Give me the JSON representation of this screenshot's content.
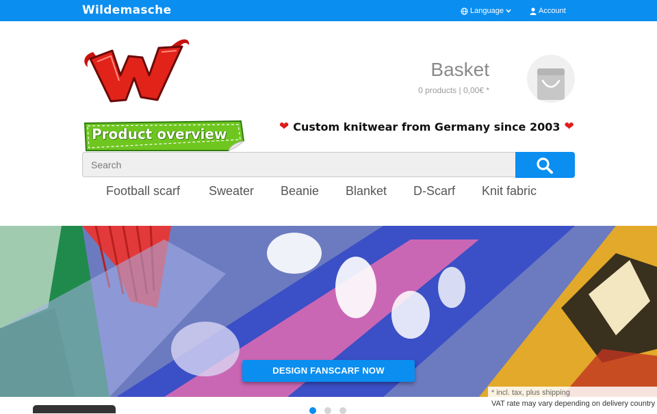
{
  "topbar": {
    "brand": "Wildemasche",
    "language_label": "Language",
    "account_label": "Account",
    "color": "#0a8ef0"
  },
  "header": {
    "basket_title": "Basket",
    "basket_info": "0 products | 0,00€ *",
    "badge_text": "Product overview",
    "tagline": "Custom knitwear from Germany since 2003"
  },
  "search": {
    "placeholder": "Search"
  },
  "categories": [
    "Football scarf",
    "Sweater",
    "Beanie",
    "Blanket",
    "D-Scarf",
    "Knit fabric"
  ],
  "hero": {
    "cta_label": "DESIGN FANSCARF NOW",
    "vat_line1": "* incl. tax, plus shipping",
    "vat_line2": "VAT rate may vary depending on delivery country"
  },
  "icons": {
    "language": "globe-icon",
    "account": "user-icon",
    "basket": "bag-icon",
    "search": "search-icon"
  }
}
